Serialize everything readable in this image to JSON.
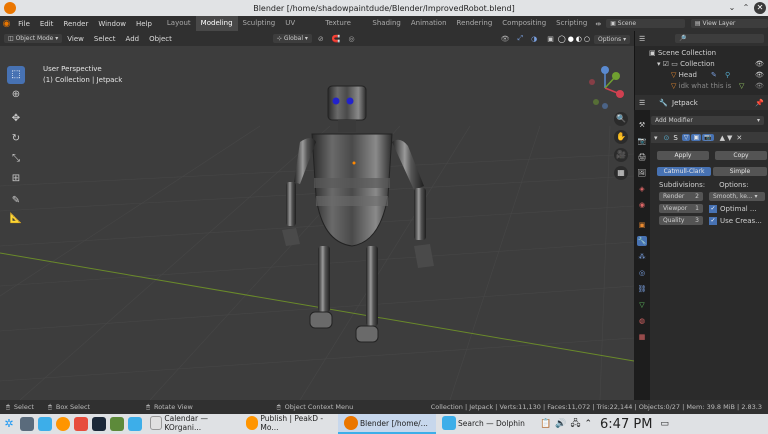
{
  "window": {
    "title": "Blender [/home/shadowpaintdude/Blender/ImprovedRobot.blend]"
  },
  "menu": {
    "items": [
      "File",
      "Edit",
      "Render",
      "Window",
      "Help"
    ],
    "workspaces": [
      "Layout",
      "Modeling",
      "Sculpting",
      "UV Editing",
      "Texture Paint",
      "Shading",
      "Animation",
      "Rendering",
      "Compositing",
      "Scripting"
    ],
    "active_workspace": "Modeling",
    "scene": "Scene",
    "view_layer": "View Layer"
  },
  "viewport_header": {
    "mode": "Object Mode",
    "menus": [
      "View",
      "Select",
      "Add",
      "Object"
    ],
    "transform_orientation": "Global",
    "options": "Options"
  },
  "viewport": {
    "perspective": "User Perspective",
    "collection_info": "(1) Collection | Jetpack",
    "gizmo": {
      "x": "X",
      "y": "Y",
      "z": "Z"
    }
  },
  "outliner": {
    "root": "Scene Collection",
    "items": [
      "Collection",
      "Head",
      "idk what this is"
    ]
  },
  "properties": {
    "object_name": "Jetpack",
    "add_modifier": "Add Modifier",
    "modifier_name": "S",
    "apply": "Apply",
    "copy": "Copy",
    "subdiv_types": [
      "Catmull-Clark",
      "Simple"
    ],
    "subdivisions_label": "Subdivisions:",
    "options_label": "Options:",
    "render_label": "Render",
    "render_value": "2",
    "viewport_label": "Viewpor",
    "viewport_value": "1",
    "quality_label": "Quality",
    "quality_value": "3",
    "smooth": "Smooth, ke...",
    "optimal": "Optimal ...",
    "use_crease": "Use Creas..."
  },
  "statusbar": {
    "select": "Select",
    "box_select": "Box Select",
    "rotate_view": "Rotate View",
    "context_menu": "Object Context Menu",
    "stats": "Collection | Jetpack | Verts:11,130 | Faces:11,072 | Tris:22,144 | Objects:0/27 | Mem: 39.8 MiB | 2.83.3"
  },
  "taskbar": {
    "apps": [
      "Calendar — KOrgani...",
      "Publish | PeakD - Mo...",
      "Blender [/home/...",
      "Search — Dolphin"
    ],
    "active_app": "Blender [/home/...",
    "clock": "6:47 PM"
  },
  "colors": {
    "accent": "#4772b3",
    "active_tab": "#3daee9"
  }
}
